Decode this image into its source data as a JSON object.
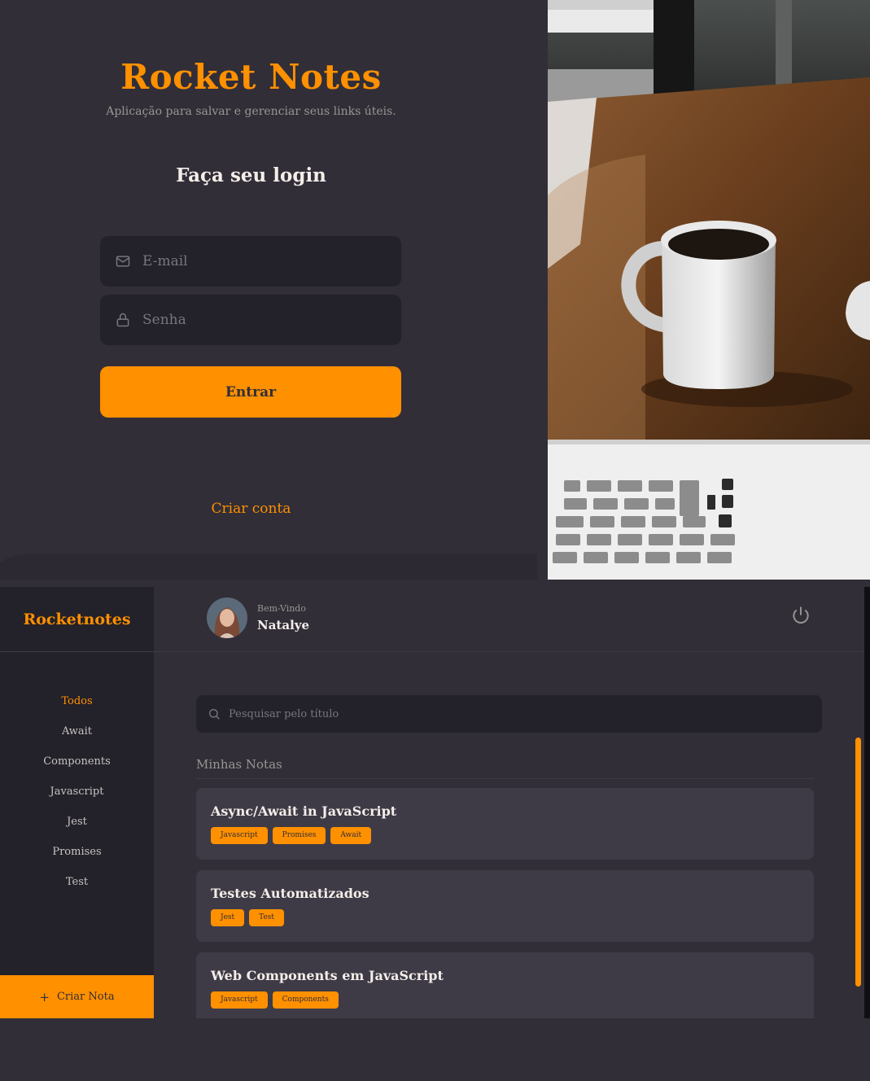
{
  "colors": {
    "background": "#312e38",
    "accent": "#ff9000",
    "input_bg": "#232129",
    "card_bg": "#3e3b47",
    "text": "#f4ede8",
    "muted": "#999591"
  },
  "login": {
    "title": "Rocket Notes",
    "subtitle": "Aplicação para salvar e gerenciar seus links úteis.",
    "heading": "Faça seu login",
    "email_placeholder": "E-mail",
    "password_placeholder": "Senha",
    "submit_label": "Entrar",
    "create_account_label": "Criar conta",
    "icons": {
      "email": "mail-icon",
      "password": "lock-icon"
    }
  },
  "home": {
    "brand": "Rocketnotes",
    "header": {
      "welcome": "Bem-Vindo",
      "username": "Natalye",
      "logout_icon": "power-icon"
    },
    "sidebar": {
      "items": [
        {
          "label": "Todos",
          "active": true
        },
        {
          "label": "Await",
          "active": false
        },
        {
          "label": "Components",
          "active": false
        },
        {
          "label": "Javascript",
          "active": false
        },
        {
          "label": "Jest",
          "active": false
        },
        {
          "label": "Promises",
          "active": false
        },
        {
          "label": "Test",
          "active": false
        }
      ],
      "create_note": {
        "icon": "plus-icon",
        "label": "Criar Nota"
      }
    },
    "search": {
      "placeholder": "Pesquisar pelo título",
      "icon": "search-icon"
    },
    "section_title": "Minhas Notas",
    "notes": [
      {
        "title": "Async/Await in JavaScript",
        "tags": [
          "Javascript",
          "Promises",
          "Await"
        ]
      },
      {
        "title": "Testes Automatizados",
        "tags": [
          "Jest",
          "Test"
        ]
      },
      {
        "title": "Web Components em JavaScript",
        "tags": [
          "Javascript",
          "Components"
        ]
      }
    ]
  }
}
